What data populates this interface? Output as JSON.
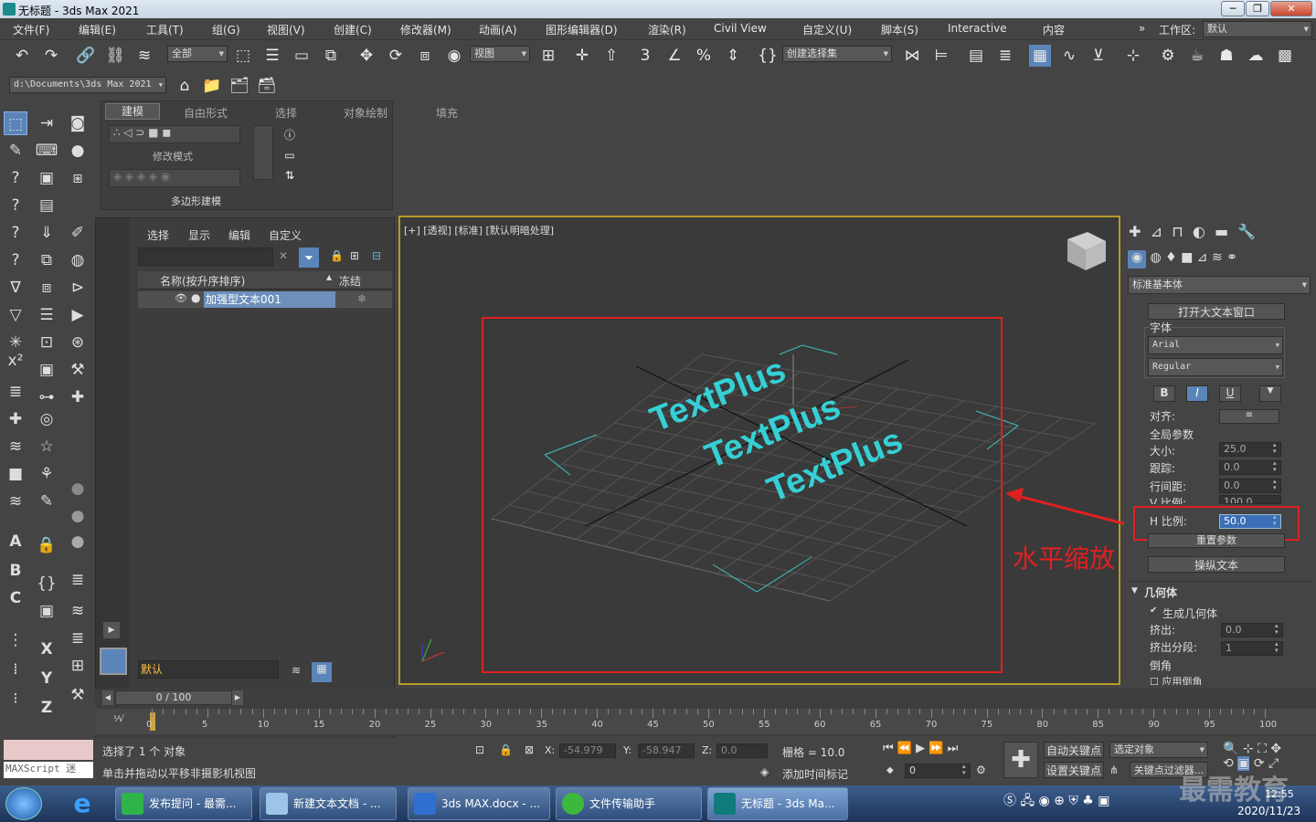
{
  "window": {
    "title": "无标题 - 3ds Max 2021",
    "workspace_label": "工作区:",
    "workspace_value": "默认"
  },
  "menu": [
    "文件(F)",
    "编辑(E)",
    "工具(T)",
    "组(G)",
    "视图(V)",
    "创建(C)",
    "修改器(M)",
    "动画(A)",
    "图形编辑器(D)",
    "渲染(R)",
    "Civil View",
    "自定义(U)",
    "脚本(S)",
    "Interactive",
    "内容"
  ],
  "toolbar": {
    "selection_filter": "全部",
    "ref_coord": "视图",
    "named_selection": "创建选择集",
    "project_path": "d:\\Documents\\3ds Max 2021"
  },
  "ribbon": {
    "tabs": [
      "建模",
      "自由形式",
      "选择",
      "对象绘制",
      "填充"
    ],
    "modify_mode": "修改模式",
    "poly_modeling": "多边形建模"
  },
  "scene_explorer": {
    "menus": [
      "选择",
      "显示",
      "编辑",
      "自定义"
    ],
    "col_name": "名称(按升序排序)",
    "col_freeze": "冻结",
    "object": "加强型文本001",
    "layer": "默认"
  },
  "viewport": {
    "label": "[+] [透视] [标准] [默认明暗处理]",
    "texts": [
      "TextPlus",
      "TextPlus",
      "TextPlus"
    ],
    "annotation": "水平缩放"
  },
  "command_panel": {
    "category": "标准基本体",
    "open_big_text": "打开大文本窗口",
    "font_group": "字体",
    "font": "Arial",
    "style": "Regular",
    "bold": "B",
    "italic": "I",
    "underline": "U",
    "align_label": "对齐:",
    "global_params": "全局参数",
    "params": [
      {
        "label": "大小:",
        "value": "25.0"
      },
      {
        "label": "跟踪:",
        "value": "0.0"
      },
      {
        "label": "行间距:",
        "value": "0.0"
      },
      {
        "label": "V 比例:",
        "value": "100.0"
      },
      {
        "label": "H 比例:",
        "value": "50.0"
      }
    ],
    "reset_params": "重置参数",
    "manip_text": "操纵文本",
    "geometry": "几何体",
    "gen_geometry": "生成几何体",
    "extrude_label": "挤出:",
    "extrude": "0.0",
    "segs_label": "挤出分段:",
    "segs": "1",
    "chamfer": "倒角",
    "apply_chamfer": "应用倒角"
  },
  "timeline": {
    "frame": "0 / 100",
    "ticks": [
      "0",
      "5",
      "10",
      "15",
      "20",
      "25",
      "30",
      "35",
      "40",
      "45",
      "50",
      "55",
      "60",
      "65",
      "70",
      "75",
      "80",
      "85",
      "90",
      "95",
      "100"
    ]
  },
  "status": {
    "selected": "选择了 1 个 对象",
    "hint": "单击并拖动以平移非摄影机视图",
    "maxscript": "MAXScript 迷",
    "x_label": "X:",
    "x": "-54.979",
    "y_label": "Y:",
    "y": "-58.947",
    "z_label": "Z:",
    "z": "0.0",
    "grid": "栅格 = 10.0",
    "add_time_tag": "添加时间标记",
    "auto_key": "自动关键点",
    "set_key": "设置关键点",
    "selected_obj": "选定对象",
    "key_filters": "关键点过滤器...",
    "frame_field": "0"
  },
  "taskbar": {
    "items": [
      "发布提问 - 最需...",
      "新建文本文档 - ...",
      "3ds MAX.docx - ...",
      "文件传输助手",
      "无标题 - 3ds Ma..."
    ],
    "time": "12:55",
    "date": "2020/11/23",
    "watermark": "最需教育"
  },
  "colors": {
    "accent": "#e02020",
    "text_cyan": "#35d0d6",
    "active_blue": "#5b84b8"
  }
}
